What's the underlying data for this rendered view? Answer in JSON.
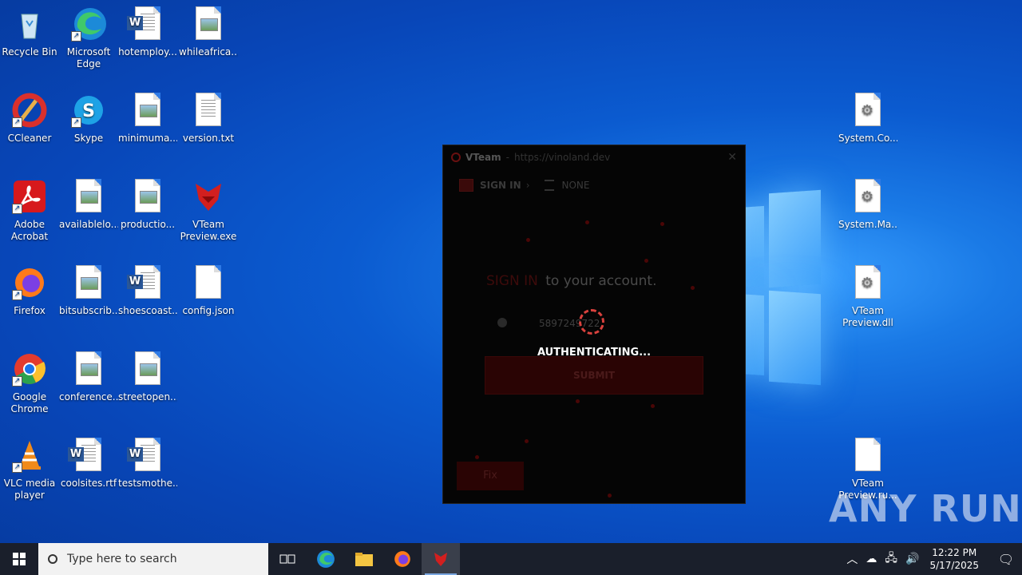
{
  "desktop": {
    "icons": [
      {
        "label": "Recycle Bin",
        "type": "recycle"
      },
      {
        "label": "Microsoft Edge",
        "type": "edge"
      },
      {
        "label": "hotemploy...",
        "type": "word"
      },
      {
        "label": "whileafrica....",
        "type": "image"
      },
      {
        "label": "CCleaner",
        "type": "ccleaner"
      },
      {
        "label": "Skype",
        "type": "skype"
      },
      {
        "label": "minimuma...",
        "type": "image"
      },
      {
        "label": "version.txt",
        "type": "text"
      },
      {
        "label": "Adobe Acrobat",
        "type": "acrobat"
      },
      {
        "label": "availablelo...",
        "type": "image"
      },
      {
        "label": "productio...",
        "type": "image"
      },
      {
        "label": "VTeam Preview.exe",
        "type": "vteam"
      },
      {
        "label": "Firefox",
        "type": "firefox"
      },
      {
        "label": "bitsubscrib...",
        "type": "image"
      },
      {
        "label": "shoescoast...",
        "type": "word"
      },
      {
        "label": "config.json",
        "type": "blank"
      },
      {
        "label": "Google Chrome",
        "type": "chrome"
      },
      {
        "label": "conference...",
        "type": "image"
      },
      {
        "label": "streetopen....",
        "type": "image"
      },
      {
        "label": "VLC media player",
        "type": "vlc"
      },
      {
        "label": "coolsites.rtf",
        "type": "word"
      },
      {
        "label": "testsmothe...",
        "type": "word"
      },
      {
        "label": "System.Co...",
        "type": "gear"
      },
      {
        "label": "System.Ma...",
        "type": "gear"
      },
      {
        "label": "VTeam Preview.dll",
        "type": "gear"
      },
      {
        "label": "VTeam Preview.ru...",
        "type": "blank"
      }
    ]
  },
  "vteam_window": {
    "app_name": "VTeam",
    "separator": "-",
    "url": "https://vinoland.dev",
    "close_glyph": "✕",
    "nav_signin": "SIGN IN",
    "nav_arrow": "›",
    "nav_none": "NONE",
    "heading_red": "SIGN IN",
    "heading_rest": "to your account.",
    "username_value": "5897249722",
    "submit_label": "SUBMIT",
    "fix_label": "Fix",
    "overlay_text": "AUTHENTICATING..."
  },
  "watermark": "ANY RUN",
  "taskbar": {
    "search_placeholder": "Type here to search",
    "time": "12:22 PM",
    "date": "5/17/2025",
    "tray_icons": [
      "chevron-up-icon",
      "onedrive-icon",
      "network-icon",
      "volume-icon"
    ]
  },
  "colors": {
    "accent_red": "#d8413d",
    "taskbar_bg": "#1a1f2b",
    "desktop_blue": "#0b5bd0"
  }
}
